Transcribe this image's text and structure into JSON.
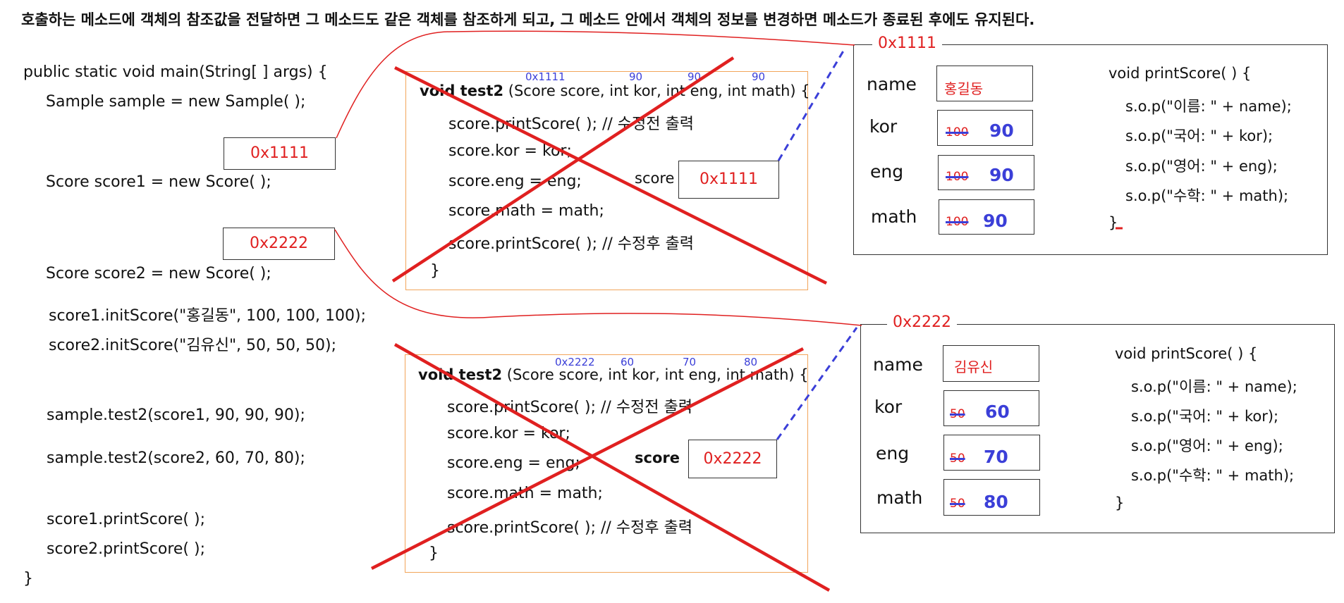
{
  "title": "호출하는 메소드에 객체의 참조값을 전달하면 그 메소드도 같은 객체를 참조하게 되고, 그 메소드 안에서 객체의 정보를 변경하면 메소드가 종료된 후에도 유지된다.",
  "main_code": {
    "line1": "public static void main(String[ ] args) {",
    "line2": "Sample sample = new Sample( );",
    "line3": "Score score1 = new Score( );",
    "line4": "Score score2 = new Score( );",
    "line5": "score1.initScore(\"홍길동\", 100, 100, 100);",
    "line6": "score2.initScore(\"김유신\", 50, 50, 50);",
    "line7": "sample.test2(score1, 90, 90, 90);",
    "line8": "sample.test2(score2, 60, 70, 80);",
    "line9": "score1.printScore( );",
    "line10": "score2.printScore( );",
    "line11": "}"
  },
  "var_refs": {
    "score1_addr": "0x1111",
    "score2_addr": "0x2222"
  },
  "test2_top": {
    "params": [
      "0x1111",
      "90",
      "90",
      "90"
    ],
    "signature_bold": "void test2",
    "signature_rest": " (Score score, int kor, int eng, int math) {",
    "body": [
      "score.printScore( ); // 수정전 출력",
      "score.kor = kor;",
      "score.eng = eng;",
      "score.math = math;",
      "score.printScore( ); // 수정후 출력",
      "}"
    ],
    "score_label": "score",
    "score_addr": "0x1111"
  },
  "test2_bottom": {
    "params": [
      "0x2222",
      "60",
      "70",
      "80"
    ],
    "signature_bold": "void test2",
    "signature_rest": " (Score score, int kor, int eng, int math) {",
    "body": [
      "score.printScore( ); // 수정전 출력",
      "score.kor = kor;",
      "score.eng = eng;",
      "score.math = math;",
      "score.printScore( ); // 수정후 출력",
      "}"
    ],
    "score_label": "score",
    "score_addr": "0x2222"
  },
  "object1": {
    "address": "0x1111",
    "fields": {
      "name_label": "name",
      "kor_label": "kor",
      "eng_label": "eng",
      "math_label": "math",
      "name_value": "홍길동",
      "kor_old": "100",
      "kor_new": "90",
      "eng_old": "100",
      "eng_new": "90",
      "math_old": "100",
      "math_new": "90"
    },
    "method": [
      "void printScore( ) {",
      "s.o.p(\"이름: \" + name);",
      "s.o.p(\"국어: \" + kor);",
      "s.o.p(\"영어: \" + eng);",
      "s.o.p(\"수학: \" + math);",
      "}"
    ]
  },
  "object2": {
    "address": "0x2222",
    "fields": {
      "name_label": "name",
      "kor_label": "kor",
      "eng_label": "eng",
      "math_label": "math",
      "name_value": "김유신",
      "kor_old": "50",
      "kor_new": "60",
      "eng_old": "50",
      "eng_new": "70",
      "math_old": "50",
      "math_new": "80"
    },
    "method": [
      "void printScore( ) {",
      "s.o.p(\"이름: \" + name);",
      "s.o.p(\"국어: \" + kor);",
      "s.o.p(\"영어: \" + eng);",
      "s.o.p(\"수학: \" + math);",
      "}"
    ]
  },
  "colors": {
    "red": "#e02020",
    "blue": "#3b3fd8",
    "orange_border": "#f2a55a"
  }
}
